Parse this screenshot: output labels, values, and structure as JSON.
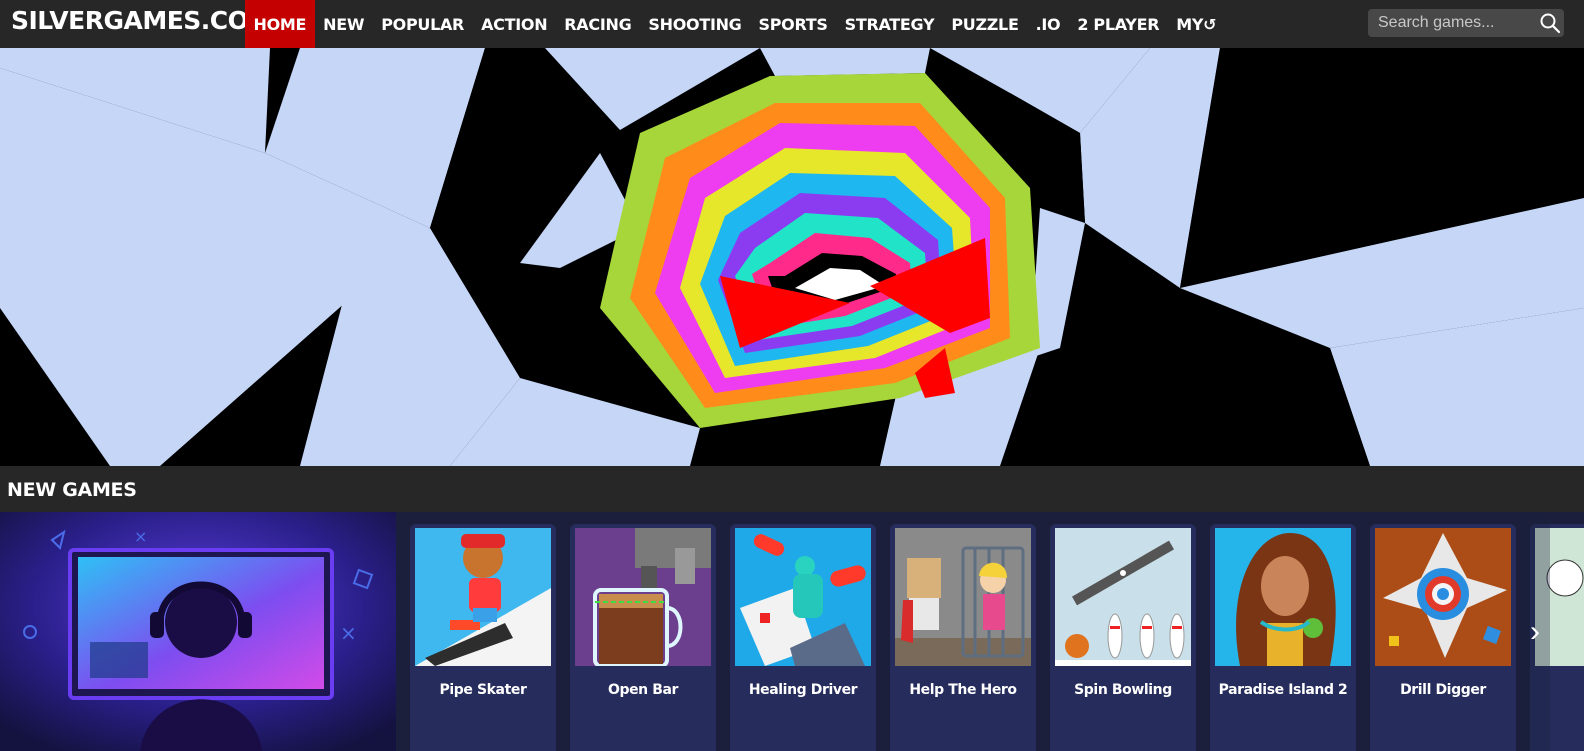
{
  "site": {
    "logo": "SILVERGAMES.COM"
  },
  "nav": {
    "items": [
      {
        "label": "HOME",
        "active": true
      },
      {
        "label": "NEW"
      },
      {
        "label": "POPULAR"
      },
      {
        "label": "ACTION"
      },
      {
        "label": "RACING"
      },
      {
        "label": "SHOOTING"
      },
      {
        "label": "SPORTS"
      },
      {
        "label": "STRATEGY"
      },
      {
        "label": "PUZZLE"
      },
      {
        "label": ".IO"
      },
      {
        "label": "2 PLAYER"
      },
      {
        "label": "MY↺"
      }
    ]
  },
  "search": {
    "placeholder": "Search games...",
    "icon": "search-icon"
  },
  "colors": {
    "topbar": "#272727",
    "active_nav": "#c40000",
    "card_bg": "#262d5c",
    "page_bg": "#1b1f3b"
  },
  "sections": {
    "new_games": {
      "title": "NEW GAMES",
      "games": [
        {
          "title": "Pipe Skater"
        },
        {
          "title": "Open Bar"
        },
        {
          "title": "Healing Driver"
        },
        {
          "title": "Help The Hero"
        },
        {
          "title": "Spin Bowling"
        },
        {
          "title": "Paradise Island 2"
        },
        {
          "title": "Drill Digger"
        }
      ],
      "next_icon": "chevron-right-icon"
    }
  }
}
